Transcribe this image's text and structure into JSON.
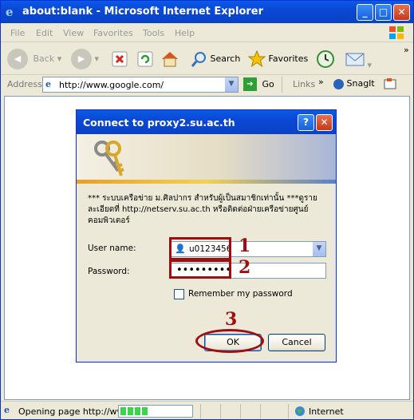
{
  "window": {
    "title": "about:blank - Microsoft Internet Explorer",
    "min": "_",
    "max": "□",
    "close": "✕"
  },
  "menu": [
    "File",
    "Edit",
    "View",
    "Favorites",
    "Tools",
    "Help"
  ],
  "toolbar": {
    "back": "Back",
    "search": "Search",
    "favorites": "Favorites"
  },
  "address": {
    "label": "Address",
    "url": "http://www.google.com/",
    "go": "Go",
    "links": "Links",
    "chevrons": "»",
    "snagit": "SnagIt"
  },
  "status": {
    "text": "Opening page http://ww",
    "zone": "Internet",
    "progress_percent": 40
  },
  "dialog": {
    "title": "Connect to proxy2.su.ac.th",
    "help": "?",
    "close": "✕",
    "message": "*** ระบบเครือข่าย ม.ศิลปากร สำหรับผู้เป็นสมาชิกเท่านั้น ***ดูรายละเอียดที่ http://netserv.su.ac.th หรือติดต่อฝ่ายเครือข่ายศูนย์คอมพิวเตอร์",
    "username_label": "User name:",
    "username_value": "u0123456",
    "password_label": "Password:",
    "password_value": "•••••••••",
    "remember": "Remember my password",
    "ok": "OK",
    "cancel": "Cancel"
  },
  "annotations": [
    "1",
    "2",
    "3"
  ],
  "colors": {
    "title_bar": "#0b48d4",
    "annotation_red": "#9e0e10",
    "dialog_bg": "#ece9d8"
  }
}
